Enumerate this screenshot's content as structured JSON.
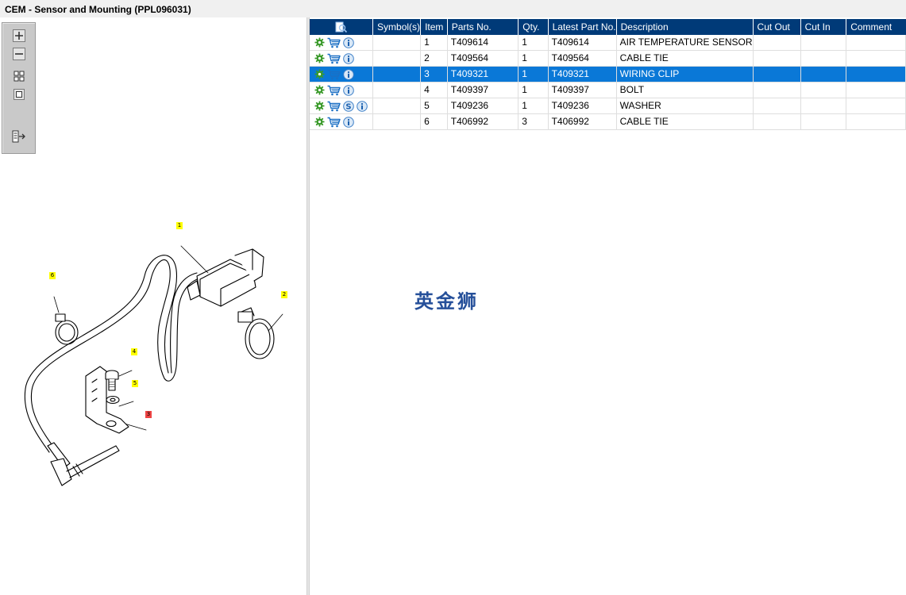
{
  "window": {
    "title": "CEM - Sensor and Mounting (PPL096031)"
  },
  "zoom_toolbar": {
    "buttons": [
      "zoom-in",
      "zoom-out",
      "fit-all",
      "actual-size",
      "export"
    ]
  },
  "diagram": {
    "callouts": [
      {
        "label": "1",
        "color": "#ffff00"
      },
      {
        "label": "2",
        "color": "#ffff00"
      },
      {
        "label": "3",
        "color": "#ee4444"
      },
      {
        "label": "4",
        "color": "#ffff00"
      },
      {
        "label": "5",
        "color": "#ffff00"
      },
      {
        "label": "6",
        "color": "#ffff00"
      }
    ]
  },
  "table": {
    "header_icon": "search-document-icon",
    "columns": [
      "Symbol(s)",
      "Item",
      "Parts No.",
      "Qty.",
      "Latest Part No.",
      "Description",
      "Cut Out",
      "Cut In",
      "Comment"
    ],
    "rows": [
      {
        "icons": [
          "gear-icon",
          "cart-icon",
          "info-icon"
        ],
        "symbols": "",
        "item": "1",
        "part_no": "T409614",
        "qty": "1",
        "latest": "T409614",
        "description": "AIR TEMPERATURE SENSOR",
        "cut_out": "",
        "cut_in": "",
        "comment": "",
        "selected": false
      },
      {
        "icons": [
          "gear-icon",
          "cart-icon",
          "info-icon"
        ],
        "symbols": "",
        "item": "2",
        "part_no": "T409564",
        "qty": "1",
        "latest": "T409564",
        "description": "CABLE TIE",
        "cut_out": "",
        "cut_in": "",
        "comment": "",
        "selected": false
      },
      {
        "icons": [
          "gear-icon",
          "cart-icon",
          "info-icon"
        ],
        "symbols": "",
        "item": "3",
        "part_no": "T409321",
        "qty": "1",
        "latest": "T409321",
        "description": "WIRING CLIP",
        "cut_out": "",
        "cut_in": "",
        "comment": "",
        "selected": true
      },
      {
        "icons": [
          "gear-icon",
          "cart-icon",
          "info-icon"
        ],
        "symbols": "",
        "item": "4",
        "part_no": "T409397",
        "qty": "1",
        "latest": "T409397",
        "description": "BOLT",
        "cut_out": "",
        "cut_in": "",
        "comment": "",
        "selected": false
      },
      {
        "icons": [
          "gear-icon",
          "cart-icon",
          "supersession-icon",
          "info-icon"
        ],
        "symbols": "",
        "item": "5",
        "part_no": "T409236",
        "qty": "1",
        "latest": "T409236",
        "description": "WASHER",
        "cut_out": "",
        "cut_in": "",
        "comment": "",
        "selected": false
      },
      {
        "icons": [
          "gear-icon",
          "cart-icon",
          "info-icon"
        ],
        "symbols": "",
        "item": "6",
        "part_no": "T406992",
        "qty": "3",
        "latest": "T406992",
        "description": "CABLE TIE",
        "cut_out": "",
        "cut_in": "",
        "comment": "",
        "selected": false
      }
    ]
  },
  "watermark": "英金狮",
  "colors": {
    "header_bg": "#003a78",
    "selected_row": "#0a78d7",
    "gear": "#3a9a2a",
    "cart": "#1a6fc4",
    "info": "#3d7fc7"
  }
}
